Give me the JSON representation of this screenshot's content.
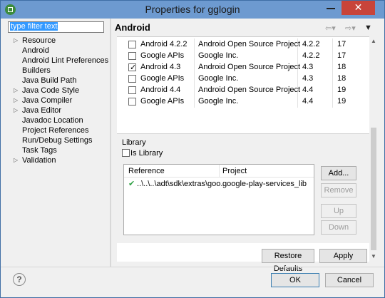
{
  "window": {
    "title": "Properties for gglogin"
  },
  "filter": {
    "value": "type filter text"
  },
  "tree": [
    {
      "label": "Resource",
      "expandable": true
    },
    {
      "label": "Android",
      "expandable": false
    },
    {
      "label": "Android Lint Preferences",
      "expandable": false
    },
    {
      "label": "Builders",
      "expandable": false
    },
    {
      "label": "Java Build Path",
      "expandable": false
    },
    {
      "label": "Java Code Style",
      "expandable": true
    },
    {
      "label": "Java Compiler",
      "expandable": true
    },
    {
      "label": "Java Editor",
      "expandable": true
    },
    {
      "label": "Javadoc Location",
      "expandable": false
    },
    {
      "label": "Project References",
      "expandable": false
    },
    {
      "label": "Run/Debug Settings",
      "expandable": false
    },
    {
      "label": "Task Tags",
      "expandable": false
    },
    {
      "label": "Validation",
      "expandable": true
    }
  ],
  "header": {
    "title": "Android",
    "back_icon": "arrow-left-icon",
    "forward_icon": "arrow-right-icon",
    "menu_icon": "chevron-down-icon"
  },
  "targets": [
    {
      "name": "Android 4.2.2",
      "vendor": "Android Open Source Project",
      "version": "4.2.2",
      "api": "17",
      "checked": false
    },
    {
      "name": "Google APIs",
      "vendor": "Google Inc.",
      "version": "4.2.2",
      "api": "17",
      "checked": false
    },
    {
      "name": "Android 4.3",
      "vendor": "Android Open Source Project",
      "version": "4.3",
      "api": "18",
      "checked": true
    },
    {
      "name": "Google APIs",
      "vendor": "Google Inc.",
      "version": "4.3",
      "api": "18",
      "checked": false
    },
    {
      "name": "Android 4.4",
      "vendor": "Android Open Source Project",
      "version": "4.4",
      "api": "19",
      "checked": false
    },
    {
      "name": "Google APIs",
      "vendor": "Google Inc.",
      "version": "4.4",
      "api": "19",
      "checked": false
    }
  ],
  "library": {
    "label": "Library",
    "is_library_label": "Is Library",
    "is_library_checked": false,
    "columns": {
      "reference": "Reference",
      "project": "Project"
    },
    "rows": [
      {
        "reference": "..\\..\\..\\adt\\sdk\\extras\\goo...",
        "project": "google-play-services_lib",
        "status_icon": "checkmark-icon"
      }
    ],
    "add_label": "Add...",
    "remove_label": "Remove",
    "up_label": "Up",
    "down_label": "Down"
  },
  "actions": {
    "restore_label": "Restore Defaults",
    "apply_label": "Apply",
    "ok_label": "OK",
    "cancel_label": "Cancel",
    "help_label": "?"
  },
  "colors": {
    "titlebar": "#6d9ad0",
    "close": "#c8443a",
    "selection": "#3399ff",
    "check_green": "#2ea043"
  }
}
